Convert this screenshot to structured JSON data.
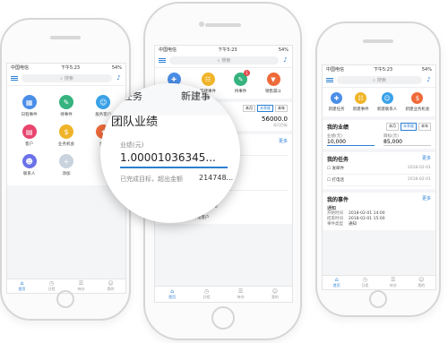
{
  "status": {
    "carrier": "中国电信",
    "time": "下午5:23",
    "battery": "54%"
  },
  "search_placeholder": "搜索",
  "tabs": [
    "首页",
    "日程",
    "待办",
    "我的"
  ],
  "left": {
    "grid": [
      {
        "label": "日程事件",
        "color": "#4a8ee8",
        "icon": "▦"
      },
      {
        "label": "待事件",
        "color": "#36b37e",
        "icon": "✎"
      },
      {
        "label": "服务客户",
        "color": "#3aa2e8",
        "icon": "☺"
      },
      {
        "label": "客户",
        "color": "#e8456e",
        "icon": "▤"
      },
      {
        "label": "业务机会",
        "color": "#f0b429",
        "icon": "$"
      },
      {
        "label": "合同",
        "color": "#ef6a3a",
        "icon": "✦"
      },
      {
        "label": "联系人",
        "color": "#6b72e8",
        "icon": "☻"
      },
      {
        "label": "添加",
        "color": "#c9d3dd",
        "icon": "+"
      }
    ]
  },
  "center": {
    "quick": [
      {
        "label": "新建任务",
        "color": "#4a8ee8",
        "icon": "✚"
      },
      {
        "label": "新建事件",
        "color": "#f0b429",
        "icon": "☷"
      },
      {
        "label": "待事件",
        "color": "#36b37e",
        "icon": "✎",
        "badge": "1"
      },
      {
        "label": "销售漏斗",
        "color": "#ef6a3a",
        "icon": "▼"
      }
    ],
    "periods": [
      "本月",
      "本季度",
      "本年"
    ],
    "achievement_value": "1.00001036345...",
    "target_value": "56000.0",
    "target_suffix": "本月目标",
    "more": "更多",
    "events": [
      {
        "title": "发邮件",
        "rows": [
          [
            "开始时间",
            "2018-02-01 14:00"
          ],
          [
            "结束时间",
            "2018-02-01 15:00"
          ],
          [
            "事件类型",
            "发邮件"
          ],
          [
            "内容",
            "发送邮件给客户"
          ]
        ]
      },
      {
        "title": "发邮件",
        "rows": [
          [
            "开始时间",
            "2018-02-01 14:00"
          ],
          [
            "结束时间",
            "2018-02-01 15:00"
          ],
          [
            "事件类型",
            "发邮件"
          ],
          [
            "内容",
            "发送邮件给客户"
          ]
        ]
      }
    ],
    "truncated_label": "件",
    "truncated_content": "内容"
  },
  "lens": {
    "tab_task": "建任务",
    "tab_new": "新建事",
    "title": "团队业绩",
    "field_label": "业绩(元)",
    "value": "1.00001036345...",
    "note": "已完成目标，超出金额",
    "note_value": "214748..."
  },
  "right": {
    "quick": [
      {
        "label": "新建任务",
        "color": "#4a8ee8",
        "icon": "✚"
      },
      {
        "label": "新建事件",
        "color": "#f0b429",
        "icon": "☷"
      },
      {
        "label": "新建联系人",
        "color": "#3aa2e8",
        "icon": "☺"
      },
      {
        "label": "新建业务机会",
        "color": "#ef6a3a",
        "icon": "$"
      }
    ],
    "perf_title": "我的业绩",
    "periods": [
      "本月",
      "本季度",
      "本年"
    ],
    "perf_label": "业绩(元)",
    "perf_value": "10,000",
    "target_label": "目标(元)",
    "target_value": "85,000",
    "tasks_title": "我的任务",
    "more": "更多",
    "tasks": [
      {
        "label": "发邮件",
        "date": "2018-02-01"
      },
      {
        "label": "打电话",
        "date": "2018-02-01"
      }
    ],
    "events_title": "我的事件",
    "event": {
      "title": "通知",
      "rows": [
        [
          "开始时间",
          "2018-02-01 14:00"
        ],
        [
          "结束时间",
          "2018-02-01 15:00"
        ],
        [
          "事件类型",
          "通知"
        ]
      ]
    }
  }
}
